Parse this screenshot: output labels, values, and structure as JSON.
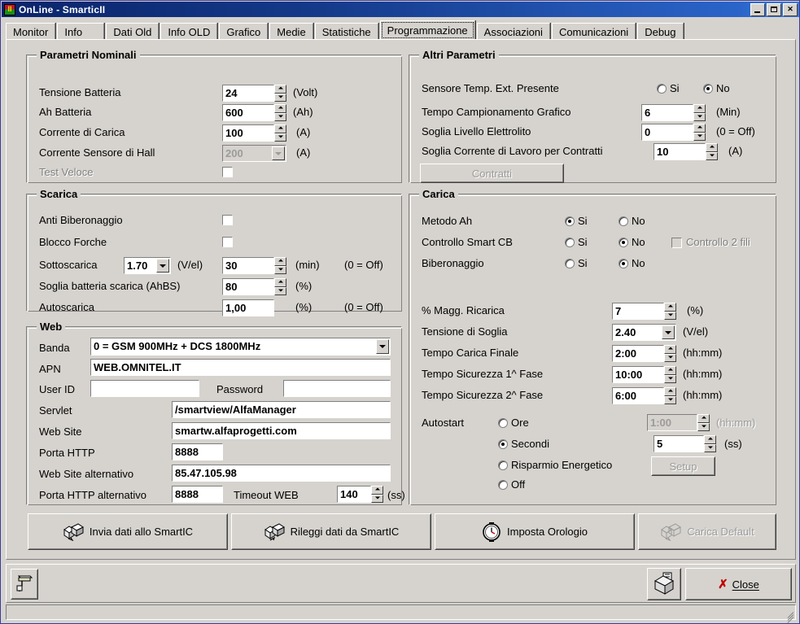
{
  "window": {
    "title": "OnLine - SmarticII",
    "icon": "app-icon",
    "minimize": "_",
    "maximize": "▭",
    "close": "×"
  },
  "tabs": [
    {
      "label": "Monitor",
      "selected": false
    },
    {
      "label": "Info",
      "selected": false
    },
    {
      "label": "Dati Old",
      "selected": false
    },
    {
      "label": "Info OLD",
      "selected": false
    },
    {
      "label": "Grafico",
      "selected": false
    },
    {
      "label": "Medie",
      "selected": false
    },
    {
      "label": "Statistiche",
      "selected": false
    },
    {
      "label": "Programmazione",
      "selected": true
    },
    {
      "label": "Associazioni",
      "selected": false
    },
    {
      "label": "Comunicazioni",
      "selected": false
    },
    {
      "label": "Debug",
      "selected": false
    }
  ],
  "parametri_nominali": {
    "title": "Parametri Nominali",
    "tensione_batteria": {
      "label": "Tensione Batteria",
      "value": "24",
      "unit": "(Volt)"
    },
    "ah_batteria": {
      "label": "Ah Batteria",
      "value": "600",
      "unit": "(Ah)"
    },
    "corrente_carica": {
      "label": "Corrente di Carica",
      "value": "100",
      "unit": "(A)"
    },
    "corrente_hall": {
      "label": "Corrente Sensore di Hall",
      "value": "200",
      "unit": "(A)"
    },
    "test_veloce": {
      "label": "Test Veloce",
      "checked": false
    }
  },
  "scarica": {
    "title": "Scarica",
    "anti_biberonaggio": {
      "label": "Anti Biberonaggio",
      "checked": false
    },
    "blocco_forche": {
      "label": "Blocco Forche",
      "checked": false
    },
    "sottoscarica": {
      "label": "Sottoscarica",
      "combo_value": "1.70",
      "combo_unit": "(V/el)",
      "value": "30",
      "unit": "(min)",
      "note": "(0 = Off)"
    },
    "soglia_batteria": {
      "label": "Soglia batteria scarica (AhBS)",
      "value": "80",
      "unit": "(%)"
    },
    "autoscarica": {
      "label": "Autoscarica",
      "value": "1,00",
      "unit": "(%)",
      "note": "(0 = Off)"
    }
  },
  "web": {
    "title": "Web",
    "banda": {
      "label": "Banda",
      "value": "0 = GSM 900MHz + DCS 1800MHz"
    },
    "apn": {
      "label": "APN",
      "value": "WEB.OMNITEL.IT"
    },
    "user_id": {
      "label": "User ID",
      "value": ""
    },
    "password": {
      "label": "Password",
      "value": ""
    },
    "servlet": {
      "label": "Servlet",
      "value": "/smartview/AlfaManager"
    },
    "web_site": {
      "label": "Web Site",
      "value": "smartw.alfaprogetti.com"
    },
    "porta_http": {
      "label": "Porta HTTP",
      "value": "8888"
    },
    "web_site_alt": {
      "label": "Web Site alternativo",
      "value": "85.47.105.98"
    },
    "porta_http_alt": {
      "label": "Porta HTTP alternativo",
      "value": "8888"
    },
    "timeout_web": {
      "label": "Timeout WEB",
      "value": "140",
      "unit": "(ss)"
    }
  },
  "altri_parametri": {
    "title": "Altri Parametri",
    "sensore_temp": {
      "label": "Sensore Temp. Ext. Presente",
      "yes": "Si",
      "no": "No",
      "selected": "No"
    },
    "tempo_campionamento": {
      "label": "Tempo Campionamento Grafico",
      "value": "6",
      "unit": "(Min)"
    },
    "soglia_elettrolito": {
      "label": "Soglia Livello Elettrolito",
      "value": "0",
      "unit": "(0 = Off)"
    },
    "soglia_corrente": {
      "label": "Soglia Corrente di Lavoro per Contratti",
      "value": "10",
      "unit": "(A)"
    },
    "contratti_button": "Contratti"
  },
  "carica": {
    "title": "Carica",
    "metodo_ah": {
      "label": "Metodo Ah",
      "yes": "Si",
      "no": "No",
      "selected": "Si"
    },
    "controllo_smart_cb": {
      "label": "Controllo Smart CB",
      "yes": "Si",
      "no": "No",
      "selected": "No"
    },
    "controllo_2_fili": {
      "label": "Controllo 2 fili",
      "checked": false
    },
    "biberonaggio": {
      "label": "Biberonaggio",
      "yes": "Si",
      "no": "No",
      "selected": "No"
    },
    "magg_ricarica": {
      "label": "% Magg. Ricarica",
      "value": "7",
      "unit": "(%)"
    },
    "tensione_soglia": {
      "label": "Tensione di Soglia",
      "value": "2.40",
      "unit": "(V/el)"
    },
    "tempo_carica_finale": {
      "label": "Tempo Carica Finale",
      "value": "2:00",
      "unit": "(hh:mm)"
    },
    "tempo_sicurezza_1": {
      "label": "Tempo Sicurezza 1^ Fase",
      "value": "10:00",
      "unit": "(hh:mm)"
    },
    "tempo_sicurezza_2": {
      "label": "Tempo Sicurezza 2^ Fase",
      "value": "6:00",
      "unit": "(hh:mm)"
    },
    "autostart": {
      "label": "Autostart",
      "selected": "Secondi",
      "options": [
        {
          "label": "Ore",
          "value": "1:00",
          "unit": "(hh:mm)"
        },
        {
          "label": "Secondi",
          "value": "5",
          "unit": "(ss)"
        },
        {
          "label": "Risparmio Energetico",
          "button": "Setup"
        },
        {
          "label": "Off"
        }
      ]
    }
  },
  "actions": {
    "invia": "Invia dati allo SmartIC",
    "rileggi": "Rileggi dati da SmartIC",
    "orologio": "Imposta Orologio",
    "default": "Carica Default"
  },
  "bottom": {
    "plug_button": "plug-icon",
    "print_button": "printer-icon",
    "close_button": "Close",
    "close_mark": "✗"
  }
}
